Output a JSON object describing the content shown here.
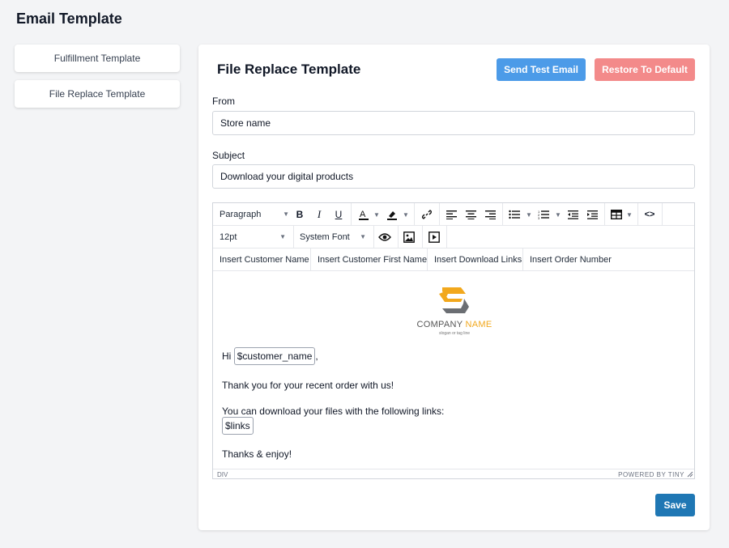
{
  "page_title": "Email Template",
  "sidebar": {
    "items": [
      {
        "label": "Fulfillment Template"
      },
      {
        "label": "File Replace Template"
      }
    ]
  },
  "card": {
    "title": "File Replace Template",
    "send_test_label": "Send Test Email",
    "restore_label": "Restore To Default",
    "from_label": "From",
    "from_value": "Store name",
    "subject_label": "Subject",
    "subject_value": "Download your digital products",
    "save_label": "Save"
  },
  "editor": {
    "block_format": "Paragraph",
    "font_size": "12pt",
    "font_family": "System Font",
    "insert_buttons": [
      {
        "label": "Insert Customer Name"
      },
      {
        "label": "Insert Customer First Name"
      },
      {
        "label": "Insert Download Links"
      },
      {
        "label": "Insert Order Number"
      }
    ],
    "content": {
      "logo_company": "COMPANY NAME",
      "logo_tagline": "slogan or tag line",
      "greeting": "Hi",
      "customer_var": "$customer_name",
      "greeting_end": ",",
      "line1": "Thank you for your recent order with us!",
      "line2": "You can download your files with the following links:",
      "links_var": "$links",
      "line3": "Thanks & enjoy!"
    },
    "status_path": "DIV",
    "powered_by": "POWERED BY TINY"
  },
  "colors": {
    "send_test": "#4c9be8",
    "restore": "#f38a8a",
    "save": "#1f77b4",
    "logo_orange": "#f2a81d",
    "logo_gray": "#6b6e73"
  }
}
